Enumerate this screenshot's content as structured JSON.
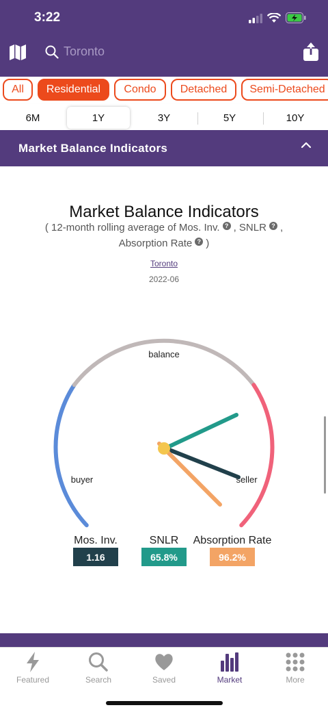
{
  "status": {
    "time": "3:22"
  },
  "search": {
    "placeholder": "Toronto"
  },
  "chips": [
    "All",
    "Residential",
    "Condo",
    "Detached",
    "Semi-Detached"
  ],
  "active_chip": "Residential",
  "periods": [
    "6M",
    "1Y",
    "3Y",
    "5Y",
    "10Y"
  ],
  "active_period": "1Y",
  "section": {
    "title": "Market Balance Indicators"
  },
  "chart": {
    "title": "Market Balance Indicators",
    "subtitle_part1": "( 12-month rolling average of Mos. Inv.",
    "subtitle_part2": ", SNLR",
    "subtitle_part3": ",",
    "subtitle_part4": "Absorption Rate",
    "subtitle_part5": ")",
    "help_glyph": "?",
    "region": "Toronto",
    "date": "2022-06",
    "zone_labels": {
      "buyer": "buyer",
      "balance": "balance",
      "seller": "seller"
    }
  },
  "chart_data": {
    "type": "gauge",
    "zones": [
      {
        "name": "buyer",
        "color": "#5b8bd9"
      },
      {
        "name": "balance",
        "color": "#c0b8b8"
      },
      {
        "name": "seller",
        "color": "#f0627a"
      }
    ],
    "indicators": [
      {
        "name": "Mos. Inv.",
        "value": "1.16",
        "color": "#21404b"
      },
      {
        "name": "SNLR",
        "value": "65.8%",
        "color": "#229a8a"
      },
      {
        "name": "Absorption Rate",
        "value": "96.2%",
        "color": "#f3a465"
      }
    ]
  },
  "tabs": [
    {
      "label": "Featured",
      "icon": "bolt-icon"
    },
    {
      "label": "Search",
      "icon": "magnifier-icon"
    },
    {
      "label": "Saved",
      "icon": "heart-icon"
    },
    {
      "label": "Market",
      "icon": "bar-chart-icon"
    },
    {
      "label": "More",
      "icon": "grid-dots-icon"
    }
  ],
  "active_tab": "Market",
  "colors": {
    "brand": "#533b7d",
    "accent": "#ec4a1c"
  }
}
